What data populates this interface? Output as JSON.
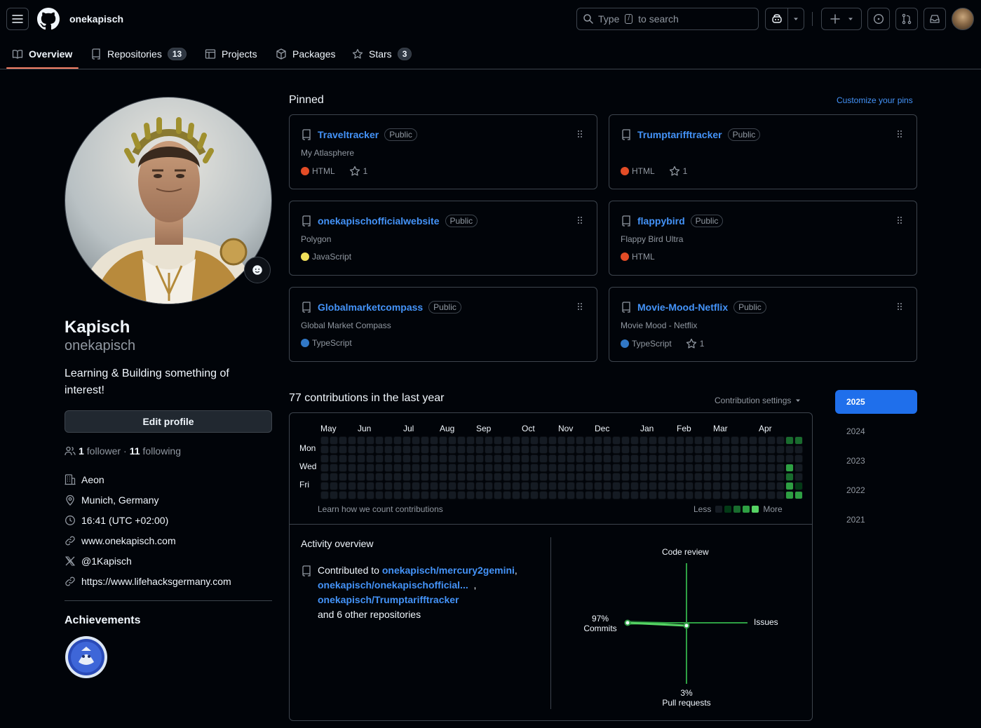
{
  "header": {
    "username": "onekapisch",
    "search_prefix": "Type",
    "search_key": "/",
    "search_suffix": "to search"
  },
  "tabs": [
    {
      "label": "Overview",
      "count": ""
    },
    {
      "label": "Repositories",
      "count": "13"
    },
    {
      "label": "Projects",
      "count": ""
    },
    {
      "label": "Packages",
      "count": ""
    },
    {
      "label": "Stars",
      "count": "3"
    }
  ],
  "profile": {
    "name": "Kapisch",
    "login": "onekapisch",
    "bio": "Learning & Building something of interest!",
    "edit_label": "Edit profile",
    "followers_count": "1",
    "followers_label": "follower",
    "sep": "·",
    "following_count": "11",
    "following_label": "following",
    "company": "Aeon",
    "location": "Munich, Germany",
    "time": "16:41",
    "tz": "(UTC +02:00)",
    "website": "www.onekapisch.com",
    "twitter": "@1Kapisch",
    "link2": "https://www.lifehacksgermany.com"
  },
  "achievements": {
    "title": "Achievements"
  },
  "pinned": {
    "title": "Pinned",
    "customize": "Customize your pins",
    "public_label": "Public",
    "repos": [
      {
        "name": "Traveltracker",
        "desc": "My Atlasphere",
        "lang": "HTML",
        "lang_color": "#e34c26",
        "stars": "1"
      },
      {
        "name": "Trumptarifftracker",
        "desc": "",
        "lang": "HTML",
        "lang_color": "#e34c26",
        "stars": "1"
      },
      {
        "name": "onekapischofficialwebsite",
        "desc": "Polygon",
        "lang": "JavaScript",
        "lang_color": "#f1e05a",
        "stars": ""
      },
      {
        "name": "flappybird",
        "desc": "Flappy Bird Ultra",
        "lang": "HTML",
        "lang_color": "#e34c26",
        "stars": ""
      },
      {
        "name": "Globalmarketcompass",
        "desc": "Global Market Compass",
        "lang": "TypeScript",
        "lang_color": "#3178c6",
        "stars": ""
      },
      {
        "name": "Movie-Mood-Netflix",
        "desc": "Movie Mood - Netflix",
        "lang": "TypeScript",
        "lang_color": "#3178c6",
        "stars": "1"
      }
    ]
  },
  "contributions": {
    "title": "77 contributions in the last year",
    "settings": "Contribution settings",
    "months": [
      "May",
      "Jun",
      "Jul",
      "Aug",
      "Sep",
      "Oct",
      "Nov",
      "Dec",
      "Jan",
      "Feb",
      "Mar",
      "Apr"
    ],
    "days": [
      "Mon",
      "Wed",
      "Fri"
    ],
    "learn": "Learn how we count contributions",
    "less": "Less",
    "more": "More",
    "active_cells": [
      [
        51,
        0,
        2
      ],
      [
        52,
        0,
        2
      ],
      [
        51,
        3,
        3
      ],
      [
        51,
        4,
        2
      ],
      [
        51,
        5,
        3
      ],
      [
        52,
        5,
        1
      ],
      [
        51,
        6,
        3
      ],
      [
        52,
        6,
        3
      ]
    ]
  },
  "activity": {
    "title": "Activity overview",
    "contributed_to": "Contributed to",
    "repo1": "onekapisch/mercury2gemini",
    "comma1": ",",
    "repo2": "onekapisch/onekapischofficial...",
    "comma2": ",",
    "repo3": "onekapisch/Trumptarifftracker",
    "others": "and 6 other repositories",
    "code_review": "Code review",
    "issues": "Issues",
    "commits_pct": "97%",
    "commits": "Commits",
    "pr_pct": "3%",
    "pull_requests": "Pull requests"
  },
  "years": [
    "2025",
    "2024",
    "2023",
    "2022",
    "2021"
  ]
}
